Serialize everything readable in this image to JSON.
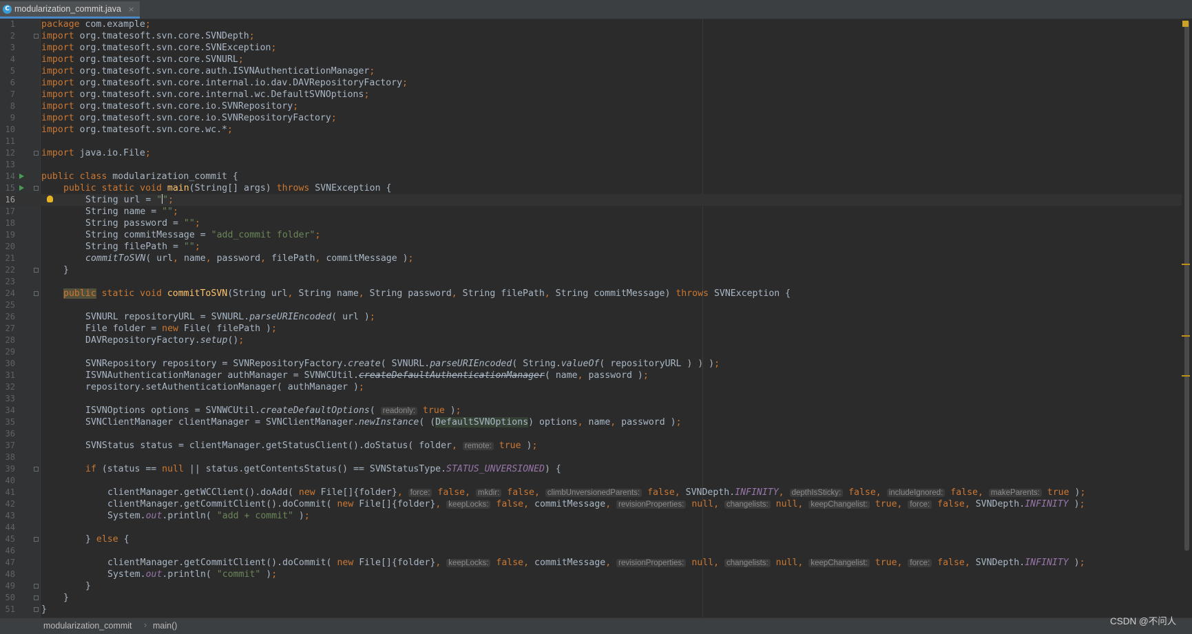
{
  "tab": {
    "file_name": "modularization_commit.java",
    "icon_letter": "C",
    "close_glyph": "×"
  },
  "editor": {
    "line_numbers": [
      "1",
      "2",
      "3",
      "4",
      "5",
      "6",
      "7",
      "8",
      "9",
      "10",
      "11",
      "12",
      "13",
      "14",
      "15",
      "16",
      "17",
      "18",
      "19",
      "20",
      "21",
      "22",
      "23",
      "24",
      "25",
      "26",
      "27",
      "28",
      "29",
      "30",
      "31",
      "32",
      "33",
      "34",
      "35",
      "36",
      "37",
      "38",
      "39",
      "40",
      "41",
      "42",
      "43",
      "44",
      "45",
      "46",
      "47",
      "48",
      "49",
      "50",
      "51"
    ],
    "lines": {
      "l1": {
        "kw": "package",
        "rest": " com.example",
        "semi": ";"
      },
      "l2": {
        "kw": "import",
        "rest": " org.tmatesoft.svn.core.SVNDepth",
        "semi": ";"
      },
      "l3": {
        "kw": "import",
        "rest": " org.tmatesoft.svn.core.SVNException",
        "semi": ";"
      },
      "l4": {
        "kw": "import",
        "rest": " org.tmatesoft.svn.core.SVNURL",
        "semi": ";"
      },
      "l5": {
        "kw": "import",
        "rest": " org.tmatesoft.svn.core.auth.ISVNAuthenticationManager",
        "semi": ";"
      },
      "l6": {
        "kw": "import",
        "rest": " org.tmatesoft.svn.core.internal.io.dav.DAVRepositoryFactory",
        "semi": ";"
      },
      "l7": {
        "kw": "import",
        "rest": " org.tmatesoft.svn.core.internal.wc.DefaultSVNOptions",
        "semi": ";"
      },
      "l8": {
        "kw": "import",
        "rest": " org.tmatesoft.svn.core.io.SVNRepository",
        "semi": ";"
      },
      "l9": {
        "kw": "import",
        "rest": " org.tmatesoft.svn.core.io.SVNRepositoryFactory",
        "semi": ";"
      },
      "l10": {
        "kw": "import",
        "rest": " org.tmatesoft.svn.core.wc.*",
        "semi": ";"
      },
      "l12": {
        "kw": "import",
        "rest": " java.io.File",
        "semi": ";"
      },
      "l14": {
        "kw": "public class",
        "rest": " modularization_commit {"
      },
      "l15": {
        "kw1": "public static void",
        "method": "main",
        "mid": "(String[] args) ",
        "kw2": "throws",
        "rest": " SVNException {"
      },
      "l16": {
        "pre": "String url = ",
        "q1": "\"",
        "q2": "\"",
        "semi": ";"
      },
      "l17": {
        "pre": "String name = ",
        "str": "\"\"",
        "semi": ";"
      },
      "l18": {
        "pre": "String password = ",
        "str": "\"\"",
        "semi": ";"
      },
      "l19": {
        "pre": "String commitMessage = ",
        "str": "\"add_commit folder\"",
        "semi": ";"
      },
      "l20": {
        "pre": "String filePath = ",
        "str": "\"\"",
        "semi": ";"
      },
      "l21": {
        "method": "commitToSVN",
        "a": "( url",
        "c1": ",",
        "b": " name",
        "c2": ",",
        "c": " password",
        "c3": ",",
        "d": " filePath",
        "c4": ",",
        "e": " commitMessage )",
        "semi": ";"
      },
      "l22": {
        "brace": "}"
      },
      "l24": {
        "kw0": "public",
        "kw1": " static void ",
        "method": "commitToSVN",
        "p1": "(String url",
        "c1": ",",
        "p2": " String name",
        "c2": ",",
        "p3": " String password",
        "c3": ",",
        "p4": " String filePath",
        "c4": ",",
        "p5": " String commitMessage) ",
        "kw2": "throws",
        "rest": " SVNException {"
      },
      "l26": {
        "pre": "SVNURL repositoryURL = SVNURL.",
        "call": "parseURIEncoded",
        "post": "( url )",
        "semi": ";"
      },
      "l27": {
        "pre": "File folder = ",
        "kw": "new",
        "post": " File( filePath )",
        "semi": ";"
      },
      "l28": {
        "pre": "DAVRepositoryFactory.",
        "call": "setup",
        "post": "()",
        "semi": ";"
      },
      "l30": {
        "pre": "SVNRepository repository = SVNRepositoryFactory.",
        "call1": "create",
        "mid1": "( SVNURL.",
        "call2": "parseURIEncoded",
        "mid2": "( String.",
        "call3": "valueOf",
        "post": "( repositoryURL ) ) )",
        "semi": ";"
      },
      "l31": {
        "pre": "ISVNAuthenticationManager authManager = SVNWCUtil.",
        "call": "createDefaultAuthenticationManager",
        "a": "( name",
        "c1": ",",
        "b": " password )",
        "semi": ";"
      },
      "l32": {
        "pre": "repository.setAuthenticationManager( authManager )",
        "semi": ";"
      },
      "l34": {
        "pre": "ISVNOptions options = SVNWCUtil.",
        "call": "createDefaultOptions",
        "open": "( ",
        "hint": "readonly:",
        "val": " true",
        "post": " )",
        "semi": ";"
      },
      "l35": {
        "pre": "SVNClientManager clientManager = SVNClientManager.",
        "call": "newInstance",
        "open": "( (",
        "cast": "DefaultSVNOptions",
        "a": ") options",
        "c1": ",",
        "b": " name",
        "c2": ",",
        "c": " password )",
        "semi": ";"
      },
      "l37": {
        "pre": "SVNStatus status = clientManager.getStatusClient().doStatus( folder",
        "c1": ",",
        "hint": "remote:",
        "val": " true",
        "post": " )",
        "semi": ";"
      },
      "l39": {
        "kw1": "if",
        "a": " (status == ",
        "kw2": "null",
        "b": " || status.getContentsStatus() == SVNStatusType.",
        "const": "STATUS_UNVERSIONED",
        "post": ") {"
      },
      "l41": {
        "pre": "clientManager.getWCClient().doAdd( ",
        "kw": "new",
        "arr": " File[]{folder}",
        "h1": "force:",
        "v1": " false",
        "h2": "mkdir:",
        "v2": " false",
        "h3": "climbUnversionedParents:",
        "v3": " false",
        "dep": " SVNDepth.",
        "const": "INFINITY",
        "h4": "depthIsSticky:",
        "v4": " false",
        "h5": "includeIgnored:",
        "v5": " false",
        "h6": "makeParents:",
        "v6": " true",
        "post": " )",
        "semi": ";",
        "comma": ","
      },
      "l42": {
        "pre": "clientManager.getCommitClient().doCommit( ",
        "kw": "new",
        "arr": " File[]{folder}",
        "h1": "keepLocks:",
        "v1": " false",
        "msg": " commitMessage",
        "h2": "revisionProperties:",
        "v2": " null",
        "h3": "changelists:",
        "v3": " null",
        "h4": "keepChangelist:",
        "v4": " true",
        "h5": "force:",
        "v5": " false",
        "dep": " SVNDepth.",
        "const": "INFINITY",
        "post": " )",
        "semi": ";",
        "comma": ","
      },
      "l43": {
        "pre": "System.",
        "field": "out",
        "mid": ".println( ",
        "str": "\"add + commit\"",
        "post": " )",
        "semi": ";"
      },
      "l45": {
        "a": "} ",
        "kw": "else",
        "b": " {"
      },
      "l47": {
        "pre": "clientManager.getCommitClient().doCommit( ",
        "kw": "new",
        "arr": " File[]{folder}",
        "h1": "keepLocks:",
        "v1": " false",
        "msg": " commitMessage",
        "h2": "revisionProperties:",
        "v2": " null",
        "h3": "changelists:",
        "v3": " null",
        "h4": "keepChangelist:",
        "v4": " true",
        "h5": "force:",
        "v5": " false",
        "dep": " SVNDepth.",
        "const": "INFINITY",
        "post": " )",
        "semi": ";",
        "comma": ","
      },
      "l48": {
        "pre": "System.",
        "field": "out",
        "mid": ".println( ",
        "str": "\"commit\"",
        "post": " )",
        "semi": ";"
      },
      "l49": {
        "brace": "}"
      },
      "l50": {
        "brace": "}"
      },
      "l51": {
        "brace": "}"
      }
    }
  },
  "breadcrumbs": {
    "class_name": "modularization_commit",
    "separator": "›",
    "method_name": "main()"
  },
  "watermark": "CSDN @不问人",
  "colors": {
    "keyword": "#cc7832",
    "string": "#6a8759",
    "method": "#ffc66d",
    "constant": "#9876aa",
    "text": "#a9b7c6",
    "background": "#2b2b2b",
    "gutter": "#313335"
  }
}
